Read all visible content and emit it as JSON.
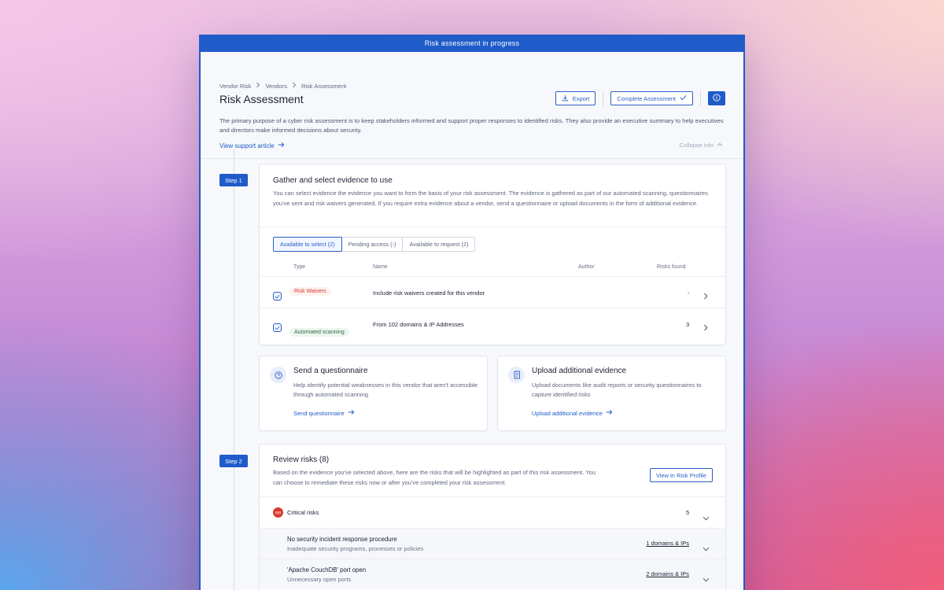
{
  "banner": {
    "text": "Risk assessment in progress"
  },
  "breadcrumb": [
    "Vendor Risk",
    "Vendors",
    "Risk Assessment"
  ],
  "page": {
    "title": "Risk Assessment",
    "description": "The primary purpose of a cyber risk assessment is to keep stakeholders informed and support proper responses to identified risks. They also provide an executive summary to help executives and directors make informed decisions about security.",
    "support_link": "View support article",
    "collapse_label": "Collapse info"
  },
  "actions": {
    "export_label": "Export",
    "complete_label": "Complete Assessment"
  },
  "step1": {
    "badge": "Step 1",
    "title": "Gather and select evidence to use",
    "description": "You can select evidence the evidence you want to form the basis of your risk assessment. The evidence is gathered as part of our automated scanning, questionnaires you've sent and risk waivers generated. If you require extra evidence about a vendor, send a questionnaire or upload documents in the form of additional evidence.",
    "tabs": [
      "Available to select (2)",
      "Pending access (-)",
      "Available to request (2)"
    ],
    "columns": [
      "Type",
      "Name",
      "Author",
      "Risks found"
    ],
    "rows": [
      {
        "type": "Risk Waivers",
        "name": "Include risk waivers created for this vendor",
        "author": "",
        "risks": "-"
      },
      {
        "type": "Automated scanning",
        "name": "From 102 domains & IP Addresses",
        "author": "",
        "risks": "3"
      }
    ]
  },
  "questionnaire_card": {
    "title": "Send a questionnaire",
    "description": "Help identify potential weaknesses in this vendor that aren't accessible through automated scanning",
    "link": "Send questionnaire"
  },
  "upload_card": {
    "title": "Upload additional evidence",
    "description": "Upload documents like audit reports or security questionnaires to capture identified risks",
    "link": "Upload additional evidence"
  },
  "step2": {
    "badge": "Step 2",
    "title": "Review risks (8)",
    "description": "Based on the evidence you've selected above, here are the risks that will be highlighted as part of this risk assessment. You can choose to remediate these risks now or after you've completed your risk assessment.",
    "view_button": "View in Risk Profile",
    "critical": {
      "label": "Critical risks",
      "count": "5"
    },
    "risks": [
      {
        "title": "No security incident response procedure",
        "subtitle": "Inadequate security programs, processes or policies",
        "link": "1 domains & IPs"
      },
      {
        "title": "'Apache CouchDB' port open",
        "subtitle": "Unnecessary open ports",
        "link": "2 domains & IPs"
      }
    ]
  },
  "colors": {
    "primary": "#1f5bc9",
    "critical": "#d73a2b",
    "risk_waiver_tag": "#d73a2b",
    "automated_tag": "#2f6b45"
  },
  "icons": [
    "download-icon",
    "check-icon",
    "info-icon",
    "chevron-right-icon",
    "arrow-right-icon",
    "chevron-up-icon",
    "chevron-down-icon",
    "question-icon",
    "document-icon",
    "critical-severity-icon"
  ]
}
